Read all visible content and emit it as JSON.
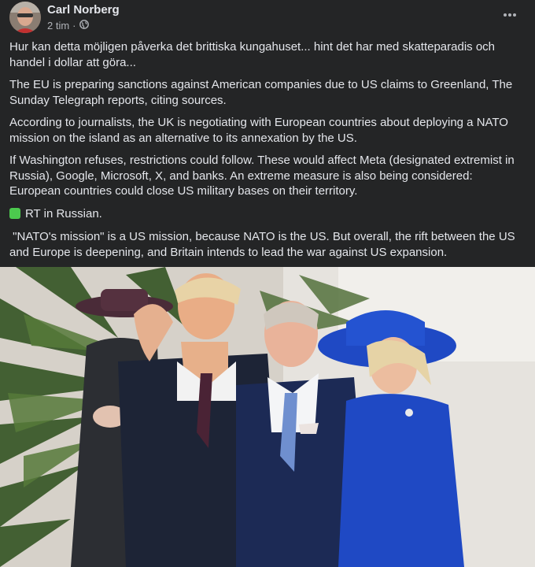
{
  "post": {
    "author": "Carl Norberg",
    "time": "2 tim",
    "separator": "·",
    "paragraphs": [
      "Hur kan detta möjligen påverka det brittiska kungahuset... hint det har med skatteparadis och handel i dollar att göra...",
      "The EU is preparing sanctions against American companies due to US claims to Greenland, The Sunday Telegraph reports, citing sources.",
      "According to journalists, the UK is negotiating with European countries about deploying a NATO mission on the island as an alternative to its annexation by the US.",
      "If Washington refuses, restrictions could follow. These would affect Meta (designated extremist in Russia), Google, Microsoft, X, and banks. An extreme measure is also being considered: European countries could close US military bases on their territory."
    ],
    "rt_line": "RT in Russian.",
    "closing": " \"NATO's mission\" is a US mission, because NATO is the US. But overall, the rift between the US and Europe is deepening, and Britain intends to lead the war against US expansion."
  },
  "icons": {
    "privacy": "globe-icon",
    "menu": "more-options-icon",
    "bullet": "green-square-icon"
  },
  "colors": {
    "background": "#242526",
    "text": "#e4e6eb",
    "secondary_text": "#b0b3b8",
    "green_square": "#4cc94e",
    "blue_outfit": "#1f49c4"
  }
}
